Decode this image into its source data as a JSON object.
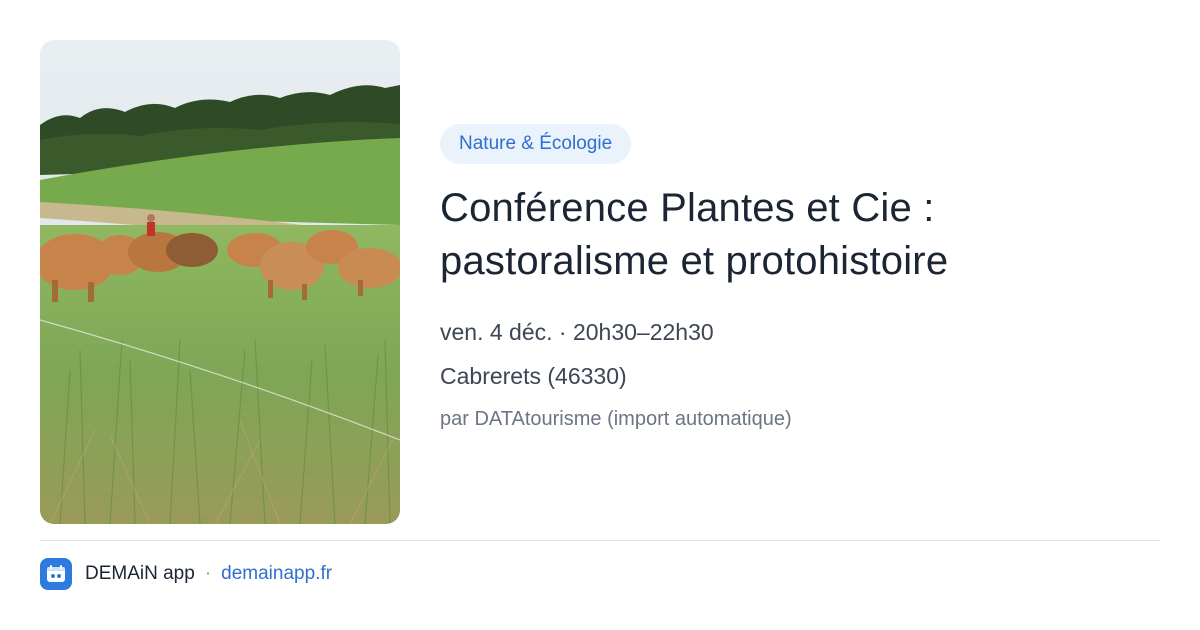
{
  "event": {
    "category": "Nature & Écologie",
    "title_line1": "Conférence Plantes et Cie :",
    "title_line2": "pastoralisme et protohistoire",
    "datetime": "ven. 4 déc. · 20h30–22h30",
    "location": "Cabrerets (46330)",
    "author": "par DATAtourisme (import automatique)"
  },
  "image": {
    "icon": "photo-cattle-grazing-icon"
  },
  "footer": {
    "app_name": "DEMAiN app",
    "separator": "·",
    "site": "demainapp.fr",
    "app_icon": "demain-app-icon"
  },
  "colors": {
    "accent": "#2f6fcf",
    "badge_bg": "#eaf2fc",
    "title": "#1b2534",
    "meta": "#3d4654",
    "muted": "#6b7584",
    "app_icon_bg": "#2d7ae0"
  }
}
